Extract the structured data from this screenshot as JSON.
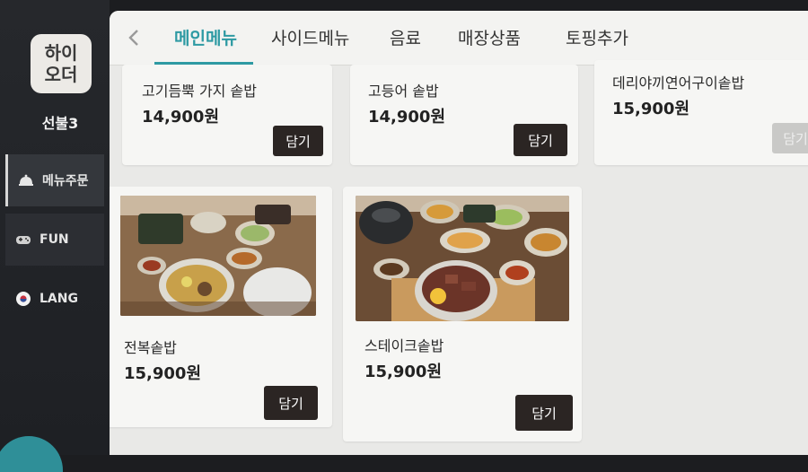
{
  "sidebar": {
    "logo": "하이\n오더",
    "store_name": "선불3",
    "items": [
      {
        "label": "메뉴주문",
        "icon": "cloche-icon"
      },
      {
        "label": "FUN",
        "icon": "gamepad-icon"
      },
      {
        "label": "LANG",
        "icon": "flag-icon"
      }
    ]
  },
  "tabs": [
    {
      "label": "메인메뉴"
    },
    {
      "label": "사이드메뉴"
    },
    {
      "label": "음료"
    },
    {
      "label": "매장상품"
    },
    {
      "label": "토핑추가"
    }
  ],
  "colors": {
    "accent": "#2e9aa3",
    "button": "#2b2523",
    "sidebar": "#23252a"
  },
  "menu": [
    {
      "name": "고기듬뿍 가지 솥밥",
      "price": "14,900원",
      "button": "담기"
    },
    {
      "name": "고등어 솥밥",
      "price": "14,900원",
      "button": "담기"
    },
    {
      "name": "데리야끼연어구이솥밥",
      "price": "15,900원",
      "button": "담기"
    },
    {
      "name": "전복솥밥",
      "price": "15,900원",
      "button": "담기"
    },
    {
      "name": "스테이크솥밥",
      "price": "15,900원",
      "button": "담기"
    }
  ]
}
